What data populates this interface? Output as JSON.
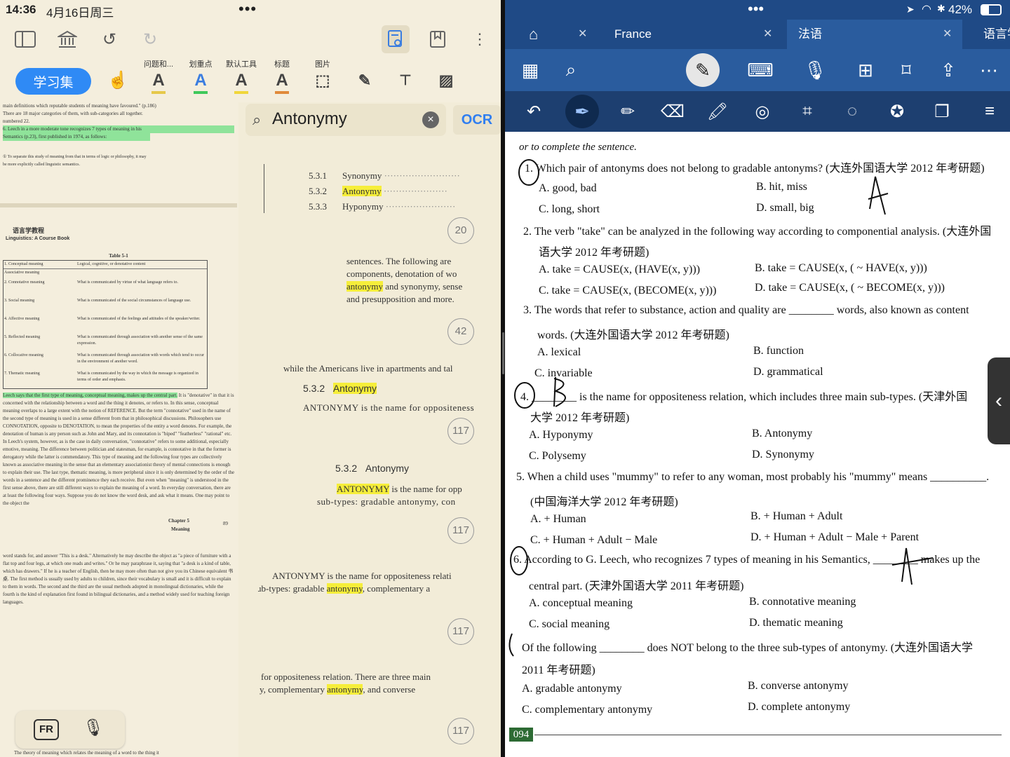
{
  "left": {
    "status": {
      "time": "14:36",
      "date": "4月16日周三",
      "dots": "•••"
    },
    "tools": {
      "xuexi": "学习集",
      "labels": [
        "问题和...",
        "划重点",
        "默认工具",
        "标题",
        "图片"
      ]
    },
    "page1": {
      "lines": [
        "main definitions which reputable students of meaning have favoured.\" (p.186)",
        "There are 18 major categories of them, with sub-categories all together.",
        "numbered 22.",
        "6. Leech in a more moderate tone recognizes 7 types of meaning in his",
        "Semantics (p.23), first published in 1974, as follows:",
        "① To separate this study of meaning from that in terms of logic or philosophy, it may",
        "be more explicitly called linguistic semantics."
      ]
    },
    "page2": {
      "header1": "语言学教程",
      "header2": "Linguistics: A Course Book",
      "table_title": "Table 5-1",
      "rows": [
        [
          "1. Conceptual meaning",
          "Logical, cognitive, or denotative content"
        ],
        [
          "Associative meaning",
          ""
        ],
        [
          "2. Connotative meaning",
          "What is communicated by virtue of what language refers to."
        ],
        [
          "3. Social meaning",
          "What is communicated of the social circumstances of language use."
        ],
        [
          "4. Affective meaning",
          "What is communicated of the feelings and attitudes of the speaker/writer."
        ],
        [
          "5. Reflected meaning",
          "What is communicated through association with another sense of the same expression."
        ],
        [
          "6. Collocative meaning",
          "What is communicated through association with words which tend to occur in the environment of another word."
        ],
        [
          "7. Thematic meaning",
          "What is communicated by the way in which the message is organized in terms of order and emphasis."
        ]
      ],
      "highlight": "Leech says that the first type of meaning, conceptual meaning, makes up the central part.",
      "body": "It is \"denotative\" in that it is concerned with the relationship between a word and the thing it denotes, or refers to. In this sense, conceptual meaning overlaps to a large extent with the notion of REFERENCE. But the term \"connotative\" used in the name of the second type of meaning is used in a sense different from that in philosophical discussions. Philosophers use CONNOTATION, opposite to DENOTATION, to mean the properties of the entity a word denotes. For example, the denotation of human is any person such as John and Mary, and its connotation is \"biped\" \"featherless\" \"rational\" etc. In Leech's system, however, as is the case in daily conversation, \"connotative\" refers to some additional, especially emotive, meaning. The difference between politician and statesman, for example, is connotative in that the former is derogatory while the latter is commendatory. This type of meaning and the following four types are collectively known as associative meaning in the sense that an elementary associationist theory of mental connections is enough to explain their use. The last type, thematic meaning, is more peripheral since it is only determined by the order of the words in a sentence and the different prominence they each receive. But even when \"meaning\" is understood in the first sense above, there are still different ways to explain the meaning of a word. In everyday conversation, there are at least the following four ways. Suppose you do not know the word desk, and ask what it means. One may point to the object the",
      "chapter": "Chapter 5",
      "chapter_sub": "Meaning",
      "page_no": "89",
      "body2": "word stands for, and answer \"This is a desk.\" Alternatively he may describe the object as \"a piece of furniture with a flat top and four legs, at which one reads and writes.\" Or he may paraphrase it, saying that \"a desk is a kind of table, which has drawers.\" If he is a teacher of English, then he may more often than not give you its Chinese equivalent 书桌. The first method is usually used by adults to children, since their vocabulary is small and it is difficult to explain to them in words. The second and the third are the usual methods adopted in monolingual dictionaries, while the fourth is the kind of explanation first found in bilingual dictionaries, and a method widely used for teaching foreign languages.",
      "foot": "The theory of meaning which relates the meaning of a word to the thing it"
    },
    "search": {
      "query": "Antonymy",
      "ocr": "OCR"
    },
    "results": [
      {
        "toc": [
          [
            "5.3.1",
            "Synonymy"
          ],
          [
            "5.3.2",
            "Antonymy"
          ],
          [
            "5.3.3",
            "Hyponymy"
          ]
        ],
        "page": "20"
      },
      {
        "lines": [
          "sentences. The following are",
          "components, denotation of wo",
          "antonymy and synonymy, sense",
          "and presupposition and more."
        ],
        "page": "42"
      },
      {
        "line1": "while the Americans live in apartments and tal",
        "heading": "5.3.2",
        "heading_word": "Antonymy",
        "line2": "ANTONYMY is the name for oppositeness",
        "page": "117"
      },
      {
        "heading": "5.3.2",
        "heading_word": "Antonymy",
        "l1a": "ANTONYMY",
        "l1b": "is the name for opp",
        "l2": "sub-types: gradable antonymy, con",
        "page": "117"
      },
      {
        "l1": "ANTONYMY is the name for oppositeness relati",
        "l2a": "ub-types: gradable",
        "l2b": "antonymy",
        "l2c": ", complementary a",
        "page": "117"
      },
      {
        "l1": "for oppositeness relation. There are three main",
        "l2a": "y, complementary",
        "l2b": "antonymy",
        "l2c": ", and converse",
        "page": "117"
      }
    ],
    "bottom": {
      "fr": "FR"
    }
  },
  "right": {
    "status": {
      "dots": "•••",
      "battery": "42%"
    },
    "tabs": [
      "France",
      "法语",
      "语言学"
    ],
    "doc": {
      "intro": "or to complete the sentence.",
      "q1": "1. Which pair of antonyms does not belong to gradable antonyms? (大连外国语大学 2012 年考研题)",
      "q1a": "A. good, bad",
      "q1b": "B. hit, miss",
      "q1c": "C. long, short",
      "q1d": "D. small, big",
      "q2": "2. The verb \"take\" can be analyzed in the following way according to componential analysis. (大连外国",
      "q2cont": "语大学 2012 年考研题)",
      "q2a": "A. take = CAUSE(x, (HAVE(x, y)))",
      "q2b": "B. take = CAUSE(x, ( ~ HAVE(x, y)))",
      "q2c": "C. take = CAUSE(x, (BECOME(x, y)))",
      "q2d": "D. take = CAUSE(x, ( ~ BECOME(x, y)))",
      "q3": "3. The words that refer to substance, action and quality are ________ words, also known as content",
      "q3cont": "words. (大连外国语大学 2012 年考研题)",
      "q3a": "A. lexical",
      "q3b": "B. function",
      "q3c": "C. invariable",
      "q3d": "D. grammatical",
      "q4": "4. ________ is the name for oppositeness relation, which includes three main sub-types. (天津外国",
      "q4cont": "大学 2012 年考研题)",
      "q4a": "A. Hyponymy",
      "q4b": "B. Antonymy",
      "q4c": "C. Polysemy",
      "q4d": "D. Synonymy",
      "q5": "5. When a child uses \"mummy\" to refer to any woman, most probably his \"mummy\" means __________.",
      "q5cont": "(中国海洋大学 2012 年考研题)",
      "q5a": "A. + Human",
      "q5b": "B. + Human + Adult",
      "q5c": "C. + Human + Adult − Male",
      "q5d": "D. + Human + Adult − Male + Parent",
      "q6": "6. According to G. Leech, who recognizes 7 types of meaning in his Semantics, ________ makes up the",
      "q6cont": "central part. (天津外国语大学 2011 年考研题)",
      "q6a": "A. conceptual meaning",
      "q6b": "B. connotative meaning",
      "q6c": "C. social meaning",
      "q6d": "D. thematic meaning",
      "q7": "Of the following ________ does NOT belong to the three sub-types of antonymy. (大连外国语大学",
      "q7cont": "2011 年考研题)",
      "q7a": "A. gradable antonymy",
      "q7b": "B. converse antonymy",
      "q7c": "C. complementary antonymy",
      "q7d": "D. complete antonymy",
      "page": "094"
    }
  }
}
